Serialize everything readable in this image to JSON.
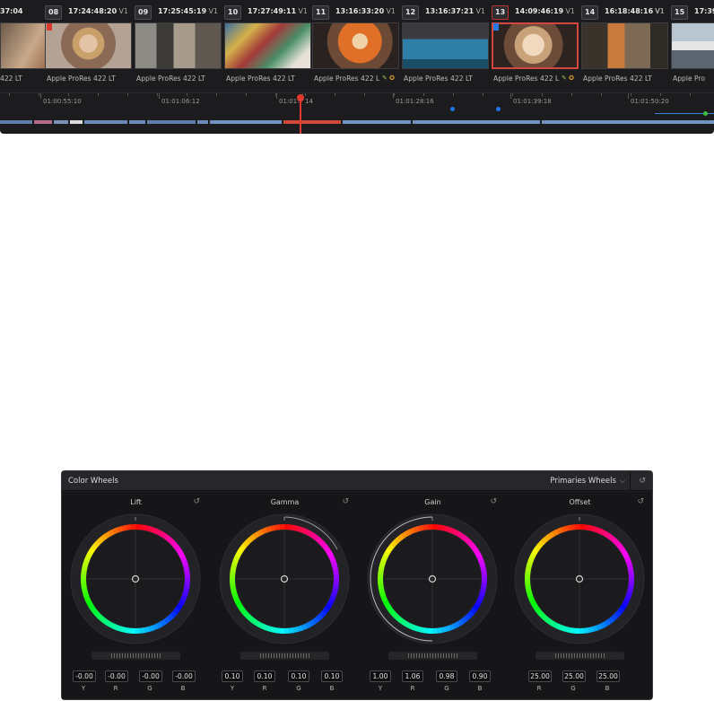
{
  "timeline": {
    "clips": [
      {
        "num": "",
        "timecode": "37:04",
        "track": "",
        "codec": "422 LT",
        "selected": false,
        "flag": "",
        "icons": false,
        "thumb": "blonde-portrait"
      },
      {
        "num": "08",
        "timecode": "17:24:48:20",
        "track": "V1",
        "codec": "Apple ProRes 422 LT",
        "selected": false,
        "flag": "#d83a2f",
        "icons": false,
        "thumb": "blonde-phone"
      },
      {
        "num": "09",
        "timecode": "17:25:45:19",
        "track": "V1",
        "codec": "Apple ProRes 422 LT",
        "selected": false,
        "flag": "",
        "icons": false,
        "thumb": "doorway"
      },
      {
        "num": "10",
        "timecode": "17:27:49:11",
        "track": "V1",
        "codec": "Apple ProRes 422 LT",
        "selected": false,
        "flag": "",
        "icons": false,
        "thumb": "graffiti"
      },
      {
        "num": "11",
        "timecode": "13:16:33:20",
        "track": "V1",
        "codec": "Apple ProRes 422 L",
        "selected": false,
        "flag": "",
        "icons": true,
        "thumb": "orange-jacket"
      },
      {
        "num": "12",
        "timecode": "13:16:37:21",
        "track": "V1",
        "codec": "Apple ProRes 422 LT",
        "selected": false,
        "flag": "",
        "icons": false,
        "thumb": "pool-table"
      },
      {
        "num": "13",
        "timecode": "14:09:46:19",
        "track": "V1",
        "codec": "Apple ProRes 422 L",
        "selected": true,
        "flag": "#2a79e0",
        "icons": true,
        "thumb": "closeup"
      },
      {
        "num": "14",
        "timecode": "16:18:48:16",
        "track": "V1",
        "codec": "Apple ProRes 422 LT",
        "selected": false,
        "flag": "",
        "icons": false,
        "thumb": "hallway"
      },
      {
        "num": "15",
        "timecode": "17:39",
        "track": "V1",
        "codec": "Apple Pro",
        "selected": false,
        "flag": "",
        "icons": false,
        "thumb": "street"
      }
    ],
    "ruler_labels": [
      "01:00:55:10",
      "01:01:06:12",
      "01:01:",
      "14",
      "01:01:28:16",
      "01:01:39:18",
      "01:01:50:20"
    ]
  },
  "panel": {
    "title": "Color Wheels",
    "mode": "Primaries Wheels",
    "mode_chevron": "⌵",
    "reset_glyph": "↺"
  },
  "wheels": [
    {
      "name": "Lift",
      "values": [
        "-0.00",
        "-0.00",
        "-0.00",
        "-0.00"
      ],
      "labels": [
        "Y",
        "R",
        "G",
        "B"
      ]
    },
    {
      "name": "Gamma",
      "values": [
        "0.10",
        "0.10",
        "0.10",
        "0.10"
      ],
      "labels": [
        "Y",
        "R",
        "G",
        "B"
      ]
    },
    {
      "name": "Gain",
      "values": [
        "1.00",
        "1.06",
        "0.98",
        "0.90"
      ],
      "labels": [
        "Y",
        "R",
        "G",
        "B"
      ]
    },
    {
      "name": "Offset",
      "values": [
        "25.00",
        "25.00",
        "25.00"
      ],
      "labels": [
        "R",
        "G",
        "B"
      ]
    }
  ],
  "colors": {
    "accent_red": "#e23a30",
    "marker_blue": "#1e73e8",
    "panel_bg": "#1e1e21"
  }
}
